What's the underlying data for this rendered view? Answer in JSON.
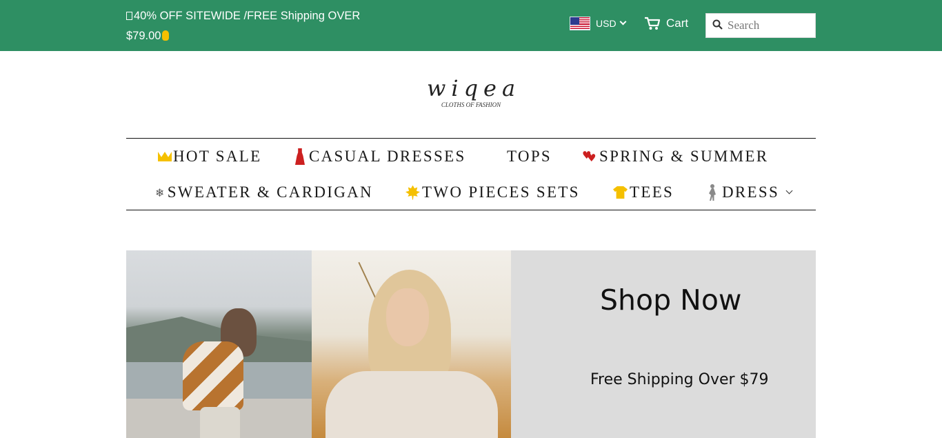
{
  "header": {
    "announcement_line1": "40% OFF SITEWIDE /FREE Shipping OVER",
    "announcement_line2": "$79.00",
    "announcement_icons": [
      "box-glyph",
      "hand-emoji"
    ],
    "currency": {
      "code": "USD",
      "flag": "us-flag-icon"
    },
    "cart": {
      "label": "Cart",
      "icon": "cart-icon"
    },
    "search": {
      "placeholder": "Search",
      "icon": "search-icon"
    },
    "colors": {
      "bar": "#2e8f63",
      "text": "#ffffff"
    }
  },
  "brand": {
    "logo": "wiqea",
    "tagline": "CLOTHS OF FASHION"
  },
  "nav": {
    "row1": [
      {
        "label": "HOT SALE",
        "icon": "crown-icon"
      },
      {
        "label": "CASUAL DRESSES",
        "icon": "dress-icon"
      },
      {
        "label": "TOPS",
        "icon": ""
      },
      {
        "label": "SPRING & SUMMER",
        "icon": "hearts-icon"
      }
    ],
    "row2": [
      {
        "label": "SWEATER & CARDIGAN",
        "icon": "snowflake-icon"
      },
      {
        "label": "TWO PIECES SETS",
        "icon": "maple-leaf-icon"
      },
      {
        "label": "TEES",
        "icon": "tshirt-icon"
      },
      {
        "label": "DRESS",
        "icon": "person-icon",
        "has_dropdown": true
      }
    ]
  },
  "hero": {
    "headline": "Shop Now",
    "subline": "Free Shipping Over $79",
    "panel_color": "#dcdcdc"
  }
}
